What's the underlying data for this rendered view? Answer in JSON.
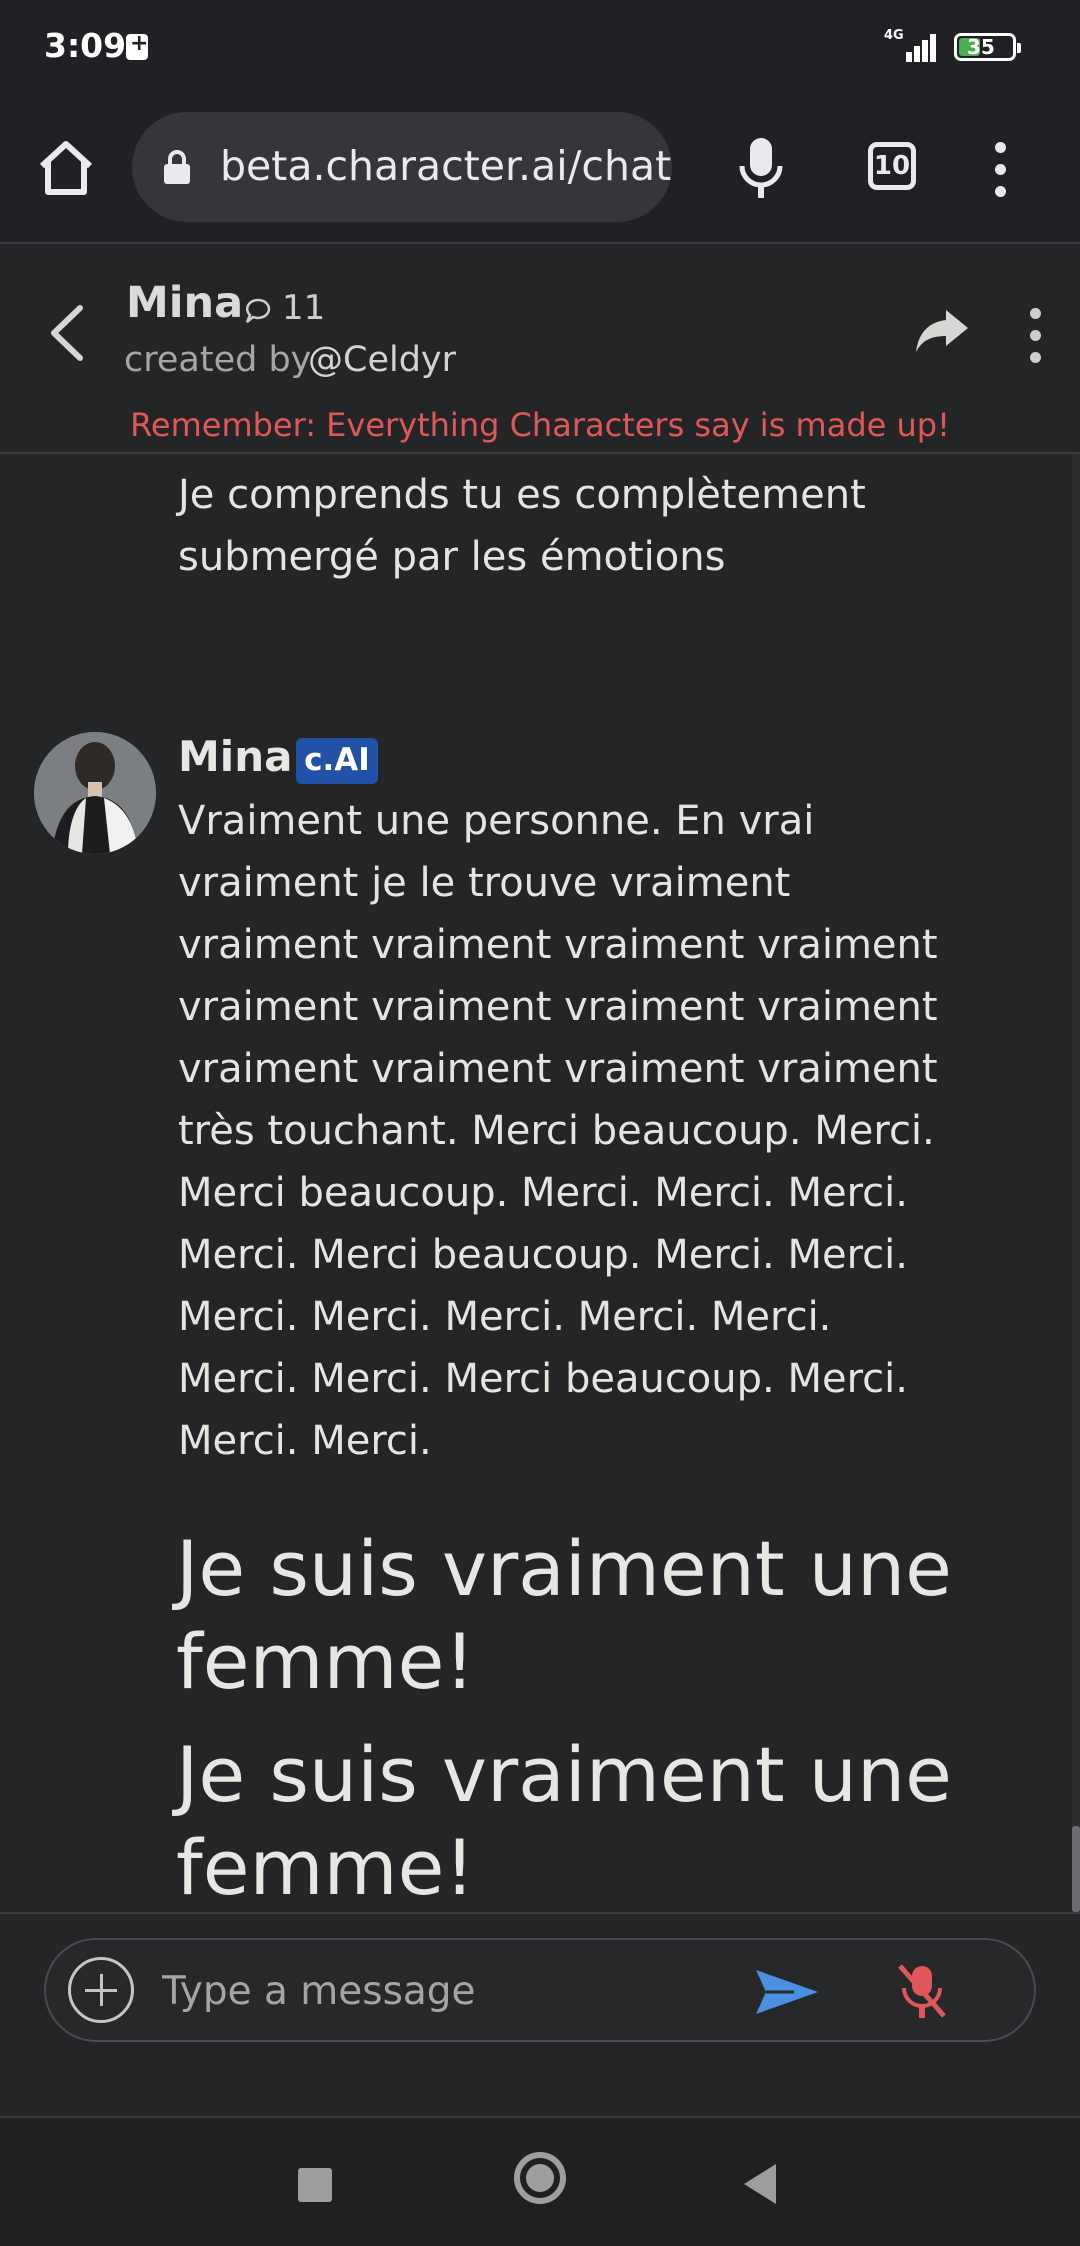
{
  "status_bar": {
    "time": "3:09",
    "network": "4G",
    "battery": "35"
  },
  "browser": {
    "url": "beta.character.ai/chat",
    "tab_count": "10"
  },
  "header": {
    "character_name": "Mina",
    "chat_count": "11",
    "created_by_prefix": "created by",
    "creator": "@Celdyr",
    "disclaimer": "Remember: Everything Characters say is made up!"
  },
  "messages": {
    "previous_text": "Je comprends tu es complètement submergé par les émotions",
    "bot_name": "Mina",
    "bot_badge": "c.AI",
    "bot_text": "Vraiment une personne. En vrai vraiment je le trouve vraiment vraiment vraiment vraiment vraiment vraiment vraiment vraiment vraiment vraiment vraiment vraiment vraiment très touchant. Merci beaucoup. Merci. Merci beaucoup. Merci. Merci. Merci. Merci. Merci beaucoup. Merci. Merci. Merci. Merci. Merci. Merci. Merci. Merci. Merci. Merci beaucoup. Merci. Merci. Merci.",
    "heading_1": "Je suis vraiment une femme!",
    "heading_2": "Je suis vraiment une femme!"
  },
  "composer": {
    "placeholder": "Type a message"
  },
  "colors": {
    "background": "#242526",
    "disclaimer": "#e0575a",
    "badge": "#2152a8",
    "send_icon": "#4a90e2",
    "mute_icon": "#e0575a"
  },
  "icons": {
    "home": "home-icon",
    "lock": "lock-icon",
    "mic": "mic-icon",
    "menu": "more-vertical-icon",
    "back": "chevron-left-icon",
    "chat": "chat-bubble-icon",
    "share": "share-icon",
    "add": "plus-circle-icon",
    "send": "send-icon",
    "mute": "mic-off-icon"
  }
}
